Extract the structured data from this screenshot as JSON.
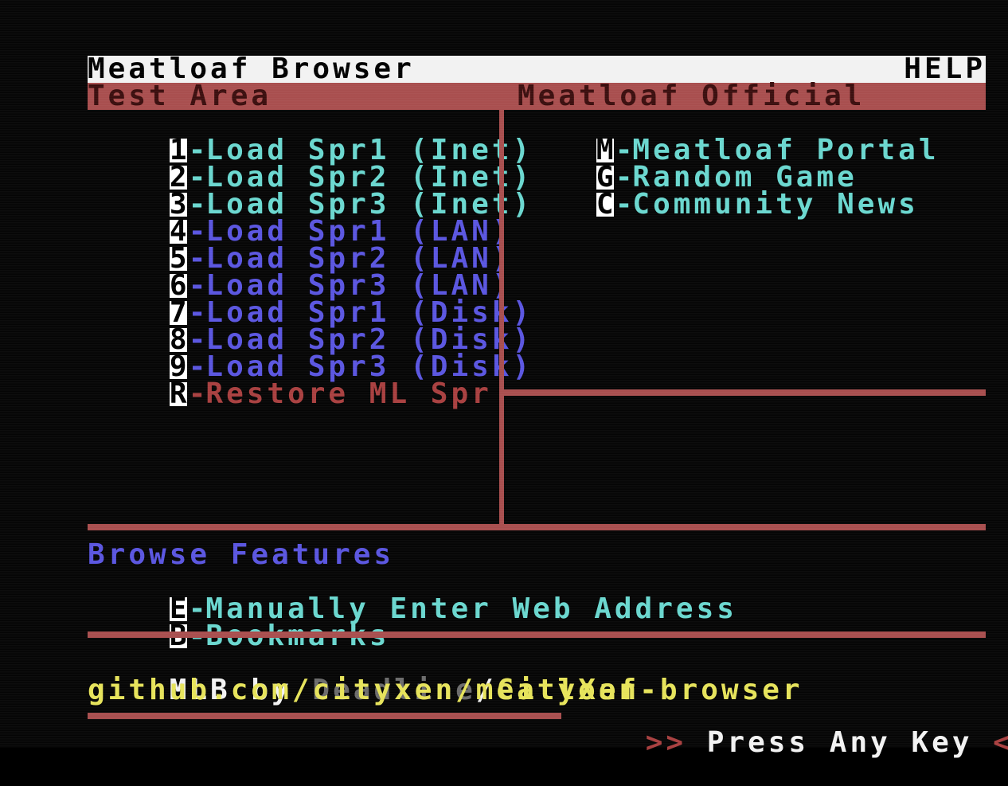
{
  "title": "Meatloaf Browser",
  "help": "HELP",
  "panels": {
    "left_heading": "Test Area",
    "right_heading": "Meatloaf Official"
  },
  "test_items": [
    {
      "key": "1",
      "label": "Load Spr1 (Inet)"
    },
    {
      "key": "2",
      "label": "Load Spr2 (Inet)"
    },
    {
      "key": "3",
      "label": "Load Spr3 (Inet)"
    },
    {
      "key": "4",
      "label": "Load Spr1 (LAN)"
    },
    {
      "key": "5",
      "label": "Load Spr2 (LAN)"
    },
    {
      "key": "6",
      "label": "Load Spr3 (LAN)"
    },
    {
      "key": "7",
      "label": "Load Spr1 (Disk)"
    },
    {
      "key": "8",
      "label": "Load Spr2 (Disk)"
    },
    {
      "key": "9",
      "label": "Load Spr3 (Disk)"
    },
    {
      "key": "R",
      "label": "Restore ML Spr"
    }
  ],
  "official_items": [
    {
      "key": "M",
      "label": "Meatloaf Portal"
    },
    {
      "key": "G",
      "label": "Random Game"
    },
    {
      "key": "C",
      "label": "Community News"
    }
  ],
  "browse": {
    "heading": "Browse Features",
    "items": [
      {
        "key": "E",
        "label": "Manually Enter Web Address"
      },
      {
        "key": "B",
        "label": "Bookmarks"
      }
    ]
  },
  "footer": {
    "credit_prefix": "MLB by ",
    "credit_author": "Deadline",
    "credit_sep": "/",
    "credit_group": "CityXen",
    "url": "github.com/cityxen/meatloaf-browser",
    "arrows_left": ">>",
    "prompt": "Press Any Key",
    "arrows_right": "<<"
  },
  "colors": {
    "background": "#050505",
    "accent_red": "#a84e4e",
    "cyan": "#6ad7cf",
    "blue": "#5a55e0",
    "yellow": "#e6e35a"
  }
}
